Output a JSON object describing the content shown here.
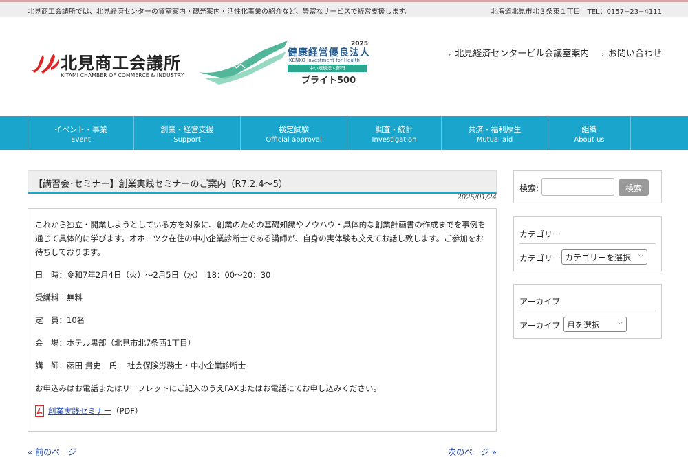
{
  "topbar": {
    "description": "北見商工会議所では、北見経済センターの貸室案内・観光案内・活性化事業の紹介など、豊富なサービスで経営支援します。",
    "address": "北海道北見市北３条東１丁目　TEL：0157−23−4111"
  },
  "logo": {
    "name": "北見商工会議所",
    "english": "KITAMI CHAMBER OF COMMERCE & INDUSTRY"
  },
  "award": {
    "year": "2025",
    "title": "健康経営優良法人",
    "subtitle": "KENKO Investment for Health",
    "band": "中小規模法人部門",
    "rank": "ブライト500"
  },
  "header_links": [
    {
      "label": "北見経済センタービル会議室案内"
    },
    {
      "label": "お問い合わせ"
    }
  ],
  "nav": [
    {
      "ja": "イベント・事業",
      "en": "Event"
    },
    {
      "ja": "創業・経営支援",
      "en": "Support"
    },
    {
      "ja": "検定試験",
      "en": "Official approval"
    },
    {
      "ja": "調査・統計",
      "en": "Investigation"
    },
    {
      "ja": "共済・福利厚生",
      "en": "Mutual aid"
    },
    {
      "ja": "組織",
      "en": "About us"
    }
  ],
  "post": {
    "title": "【講習会･セミナー】創業実践セミナーのご案内（R7.2.4〜5）",
    "date": "2025/01/24",
    "intro": "これから独立・開業しようとしている方を対象に、創業のための基礎知識やノウハウ・具体的な創業計画書の作成までを事例を通じて具体的に学びます。オホーツク在住の中小企業診断士である講師が、自身の実体験も交えてお話し致します。ご参加をお待ちしております。",
    "schedule": "日　時：令和7年2月4日（火）〜2月5日（水）　18：00〜20：30",
    "fee": "受講料：無料",
    "capacity": "定　員：10名",
    "venue": "会　場：ホテル黒部（北見市北7条西1丁目）",
    "lecturer": "講　師：藤田 貴史　氏　 社会保険労務士・中小企業診断士",
    "apply": "お申込みはお電話またはリーフレットにご記入のうえFAXまたはお電話にてお申し込みください。",
    "pdf_link": "創業実践セミナー",
    "pdf_suffix": "（PDF）"
  },
  "pager": {
    "prev": "« 前のページ",
    "next": "次のページ »"
  },
  "sidebar": {
    "search_label": "検索:",
    "search_value": "",
    "search_button": "検索",
    "category_title": "カテゴリー",
    "category_label": "カテゴリー",
    "category_selected": "カテゴリーを選択",
    "archive_title": "アーカイブ",
    "archive_label": "アーカイブ",
    "archive_selected": "月を選択"
  },
  "colors": {
    "nav_bg": "#1aa6cc",
    "link": "#1a3fa8",
    "logo_red": "#e02424",
    "award_green": "#29a88f"
  }
}
